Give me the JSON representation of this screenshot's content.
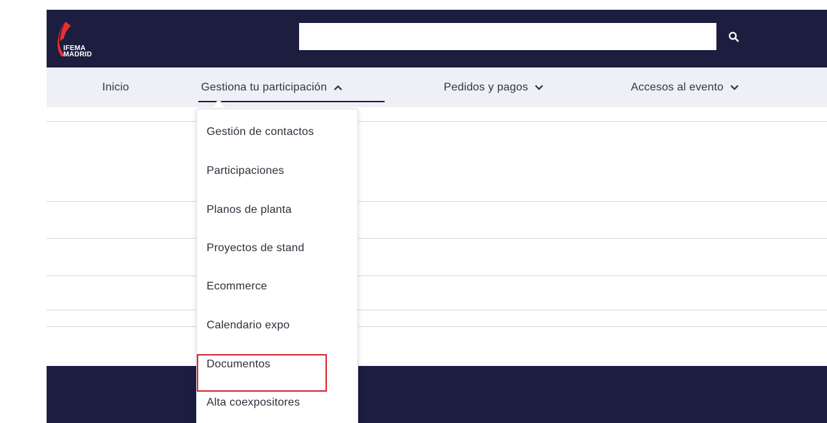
{
  "brand": {
    "logo_line1": "IFEMA",
    "logo_line2": "MADRID"
  },
  "search": {
    "value": "",
    "placeholder": ""
  },
  "nav": {
    "items": [
      {
        "label": "Inicio"
      },
      {
        "label": "Gestiona tu participación"
      },
      {
        "label": "Pedidos y pagos"
      },
      {
        "label": "Accesos al evento"
      }
    ]
  },
  "dropdown": {
    "items": [
      {
        "label": "Gestión de contactos"
      },
      {
        "label": "Participaciones"
      },
      {
        "label": "Planos de planta"
      },
      {
        "label": "Proyectos de stand"
      },
      {
        "label": "Ecommerce"
      },
      {
        "label": "Calendario expo"
      },
      {
        "label": "Documentos"
      },
      {
        "label": "Alta coexpositores"
      }
    ]
  },
  "colors": {
    "header_bg": "#1c1d3f",
    "nav_bg": "#eff0f5",
    "logo_red": "#e8312c",
    "highlight": "#d62a2f"
  },
  "icons": {
    "search": "search-icon",
    "chevron_up": "chevron-up-icon",
    "chevron_down": "chevron-down-icon"
  }
}
